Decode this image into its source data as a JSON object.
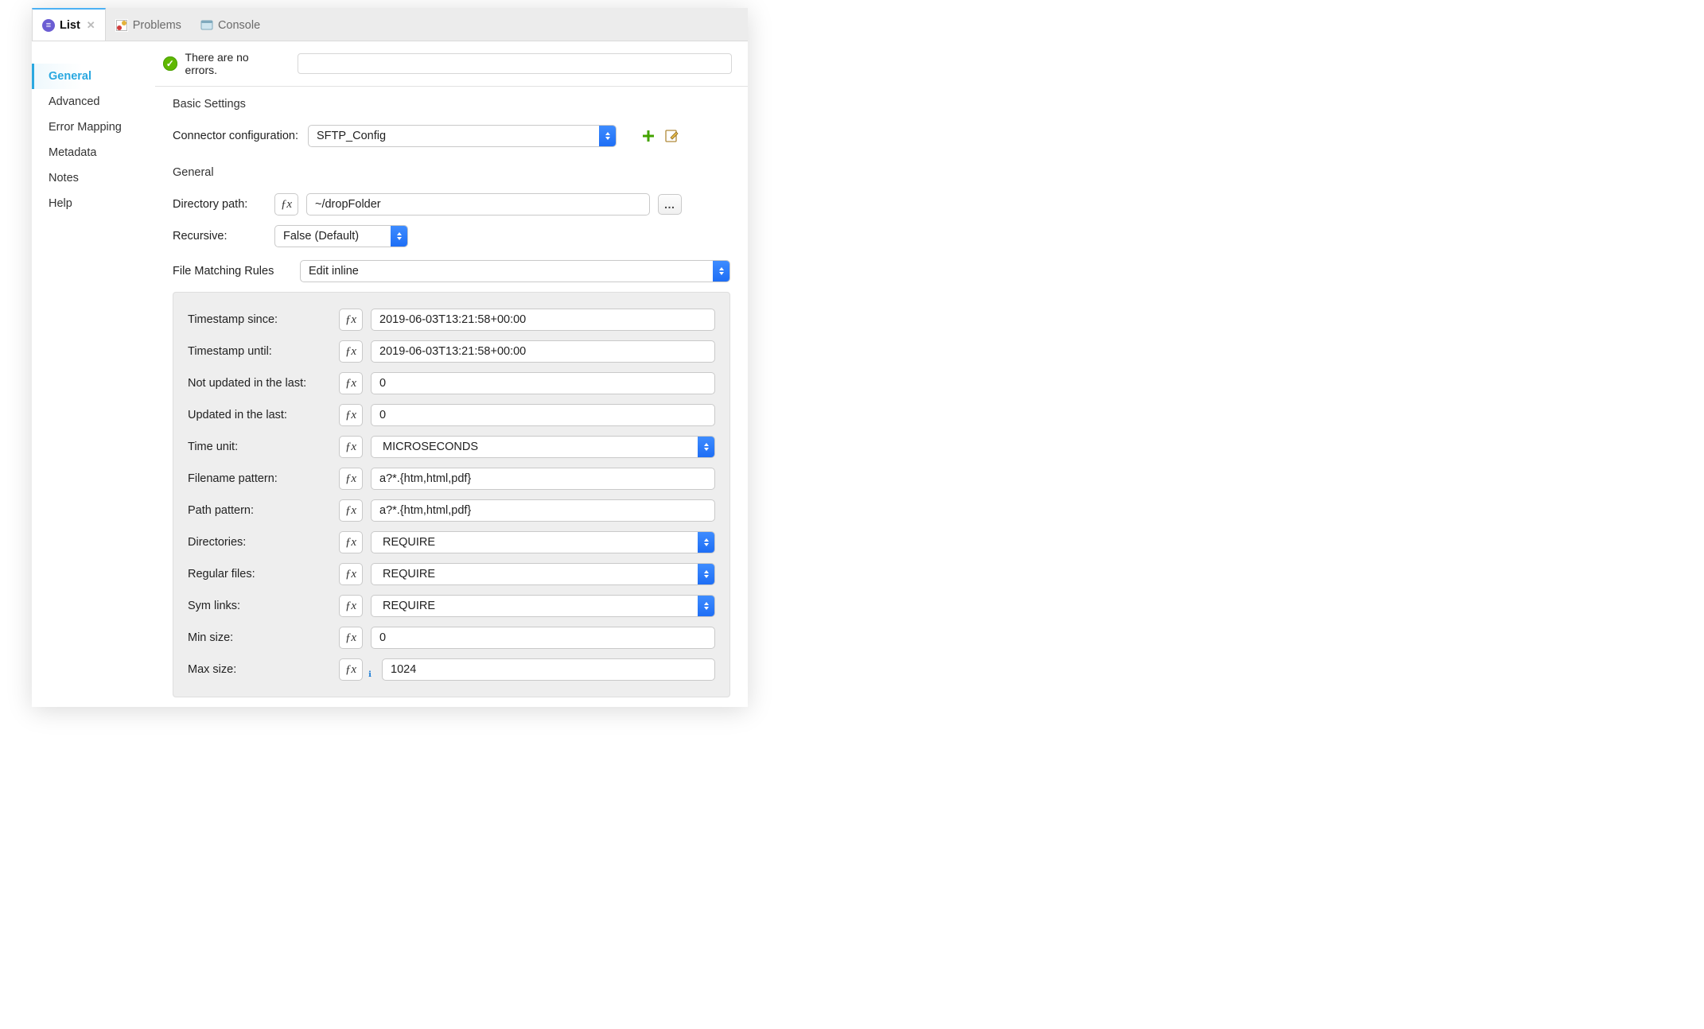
{
  "tabs": {
    "list": {
      "label": "List"
    },
    "problems": {
      "label": "Problems"
    },
    "console": {
      "label": "Console"
    }
  },
  "sidebar": {
    "items": [
      {
        "label": "General"
      },
      {
        "label": "Advanced"
      },
      {
        "label": "Error Mapping"
      },
      {
        "label": "Metadata"
      },
      {
        "label": "Notes"
      },
      {
        "label": "Help"
      }
    ]
  },
  "status": {
    "message": "There are no errors."
  },
  "basic": {
    "title": "Basic Settings",
    "connector_label": "Connector configuration:",
    "connector_value": "SFTP_Config"
  },
  "general": {
    "title": "General",
    "directory_label": "Directory path:",
    "directory_value": "~/dropFolder",
    "recursive_label": "Recursive:",
    "recursive_value": "False (Default)",
    "file_rules_label": "File Matching Rules",
    "file_rules_mode": "Edit inline"
  },
  "rules": {
    "ts_since_label": "Timestamp since:",
    "ts_since_value": "2019-06-03T13:21:58+00:00",
    "ts_until_label": "Timestamp until:",
    "ts_until_value": "2019-06-03T13:21:58+00:00",
    "not_upd_label": "Not updated in the last:",
    "not_upd_value": "0",
    "upd_label": "Updated in the last:",
    "upd_value": "0",
    "time_unit_label": "Time unit:",
    "time_unit_value": "MICROSECONDS",
    "fn_pat_label": "Filename pattern:",
    "fn_pat_value": "a?*.{htm,html,pdf}",
    "path_pat_label": "Path pattern:",
    "path_pat_value": "a?*.{htm,html,pdf}",
    "dirs_label": "Directories:",
    "dirs_value": "REQUIRE",
    "reg_label": "Regular files:",
    "reg_value": "REQUIRE",
    "sym_label": "Sym links:",
    "sym_value": "REQUIRE",
    "min_label": "Min size:",
    "min_value": "0",
    "max_label": "Max size:",
    "max_value": "1024"
  }
}
